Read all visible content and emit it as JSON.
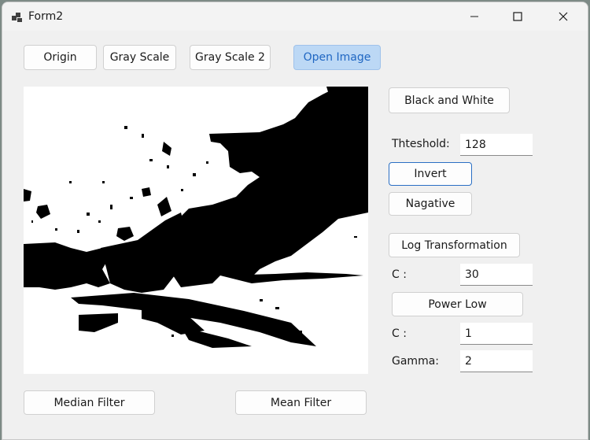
{
  "window": {
    "title": "Form2"
  },
  "toolbar": {
    "origin": "Origin",
    "gray_scale": "Gray Scale",
    "gray_scale_2": "Gray Scale 2",
    "open_image": "Open Image"
  },
  "controls": {
    "black_and_white": "Black and White",
    "threshold_label": "Thteshold:",
    "threshold_value": "128",
    "invert": "Invert",
    "negative": "Nagative",
    "log_transformation": "Log Transformation",
    "log_c_label": "C :",
    "log_c_value": "30",
    "power_low": "Power Low",
    "power_c_label": "C :",
    "power_c_value": "1",
    "gamma_label": "Gamma:",
    "gamma_value": "2"
  },
  "filters": {
    "median": "Median Filter",
    "mean": "Mean Filter"
  },
  "icons": [
    "app-icon",
    "minimize-icon",
    "maximize-icon",
    "close-icon"
  ]
}
